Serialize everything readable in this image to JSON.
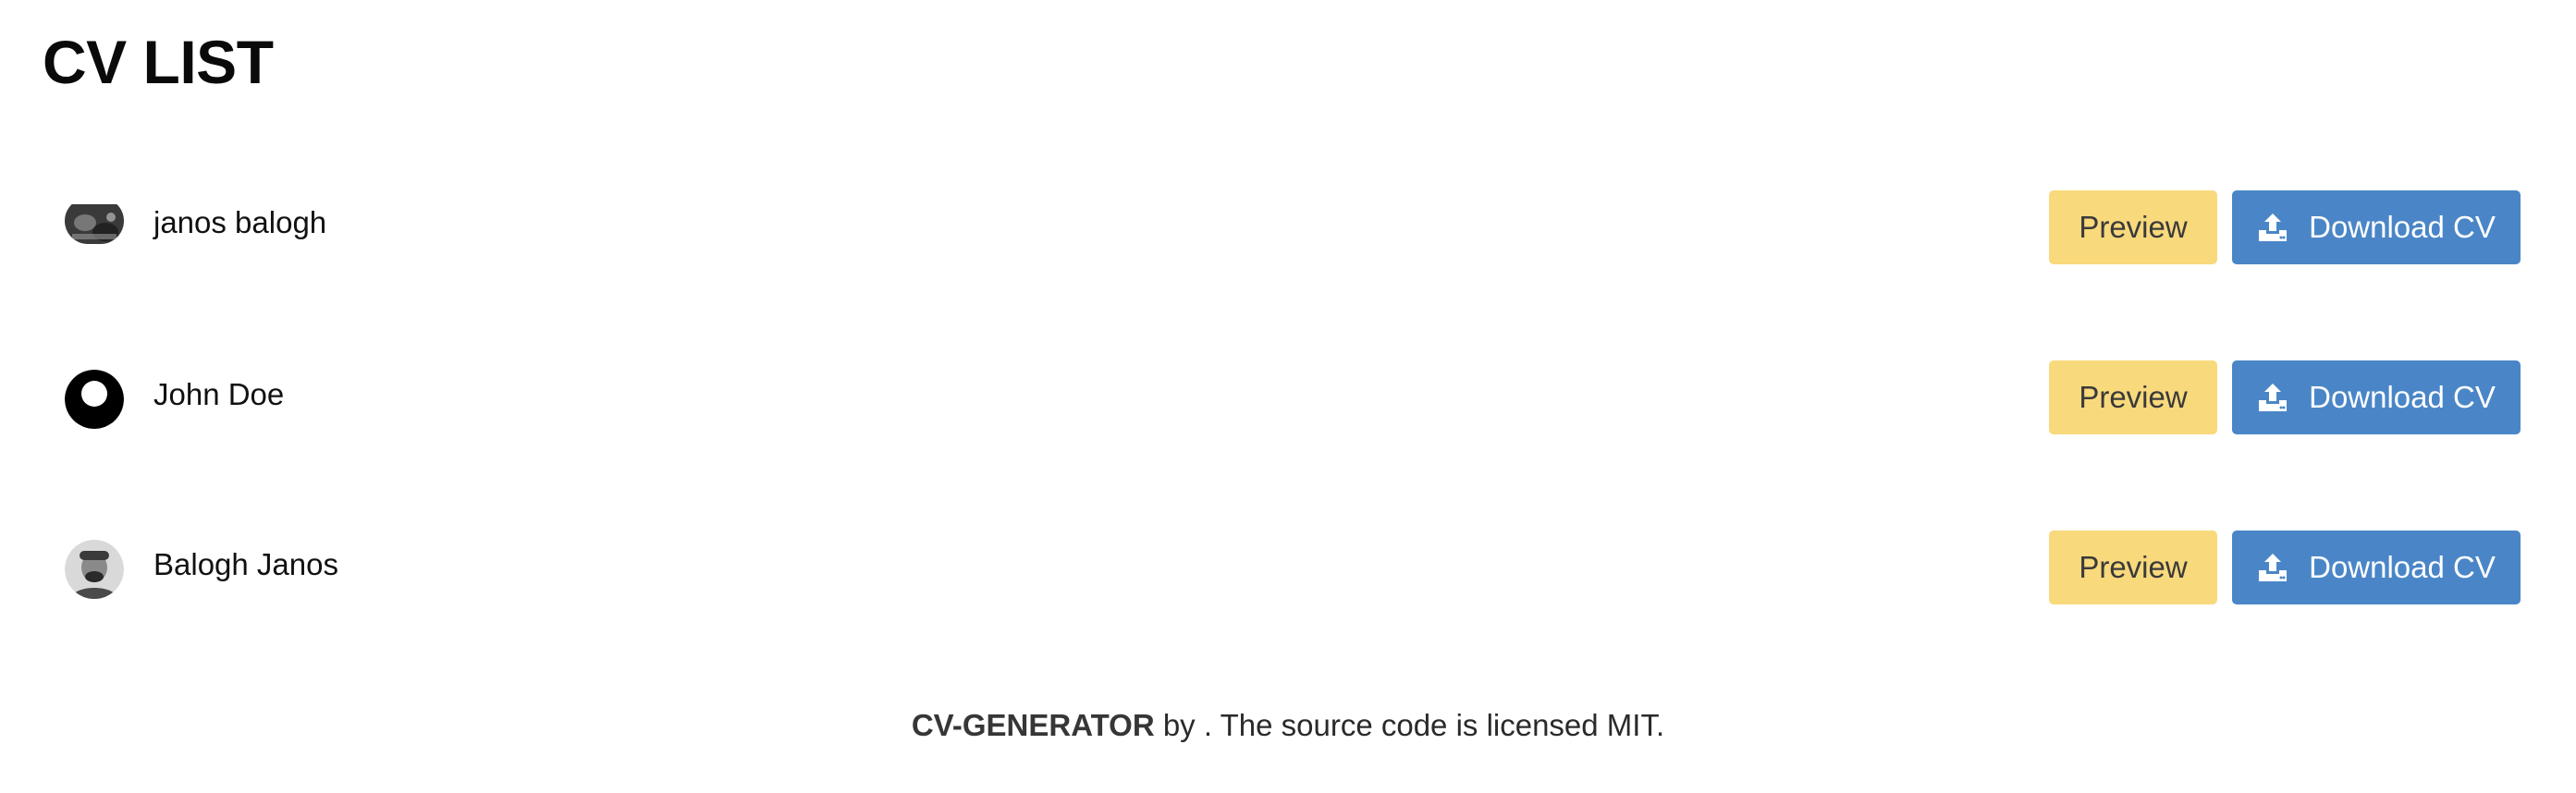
{
  "page": {
    "title": "CV LIST"
  },
  "cv_items": [
    {
      "name": "janos balogh",
      "avatar": "photo-avatar",
      "preview_label": "Preview",
      "download_label": "Download CV",
      "download_icon": "upload-icon"
    },
    {
      "name": "John Doe",
      "avatar": "default-user-avatar",
      "preview_label": "Preview",
      "download_label": "Download CV",
      "download_icon": "upload-icon"
    },
    {
      "name": "Balogh Janos",
      "avatar": "photo-avatar",
      "preview_label": "Preview",
      "download_label": "Download CV",
      "download_icon": "upload-icon"
    }
  ],
  "footer": {
    "brand": "CV-GENERATOR",
    "text": " by . The source code is licensed MIT."
  },
  "colors": {
    "preview_button": "#f8d97c",
    "download_button": "#4a86c7",
    "title": "#0a0a0a"
  }
}
